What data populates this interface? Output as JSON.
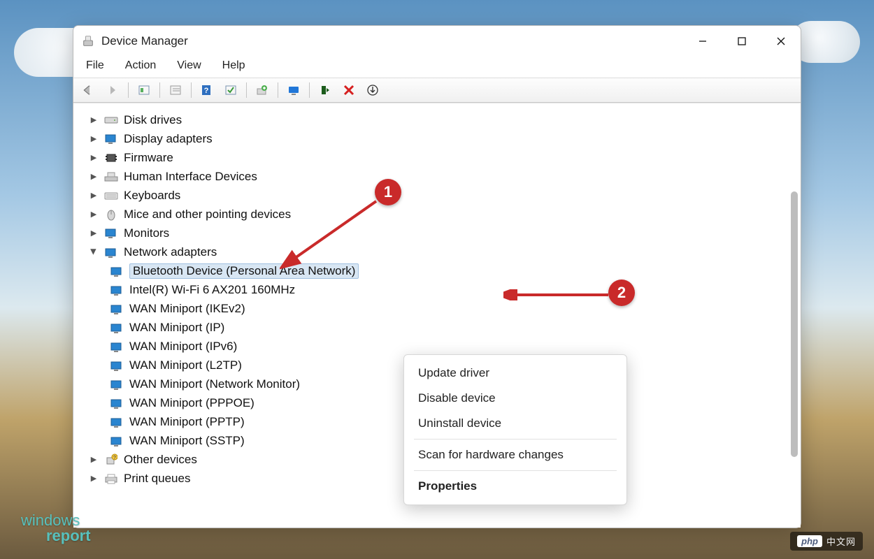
{
  "annotations": {
    "badge1": "1",
    "badge2": "2"
  },
  "watermark": {
    "line1": "windows",
    "line2": "report"
  },
  "php_badge": {
    "logo": "php",
    "text": "中文网"
  },
  "titlebar": {
    "title": "Device Manager"
  },
  "menubar": {
    "file": "File",
    "action": "Action",
    "view": "View",
    "help": "Help"
  },
  "context_menu": {
    "update": "Update driver",
    "disable": "Disable device",
    "uninstall": "Uninstall device",
    "scan": "Scan for hardware changes",
    "properties": "Properties"
  },
  "tree": {
    "disk_drives": "Disk drives",
    "display_adapters": "Display adapters",
    "firmware": "Firmware",
    "hid": "Human Interface Devices",
    "keyboards": "Keyboards",
    "mice": "Mice and other pointing devices",
    "monitors": "Monitors",
    "network_adapters": "Network adapters",
    "network_children": {
      "bluetooth": "Bluetooth Device (Personal Area Network)",
      "intel_wifi": "Intel(R) Wi-Fi 6 AX201 160MHz",
      "wan_ikev2": "WAN Miniport (IKEv2)",
      "wan_ip": "WAN Miniport (IP)",
      "wan_ipv6": "WAN Miniport (IPv6)",
      "wan_l2tp": "WAN Miniport (L2TP)",
      "wan_netmon": "WAN Miniport (Network Monitor)",
      "wan_pppoe": "WAN Miniport (PPPOE)",
      "wan_pptp": "WAN Miniport (PPTP)",
      "wan_sstp": "WAN Miniport (SSTP)"
    },
    "other_devices": "Other devices",
    "print_queues": "Print queues"
  }
}
